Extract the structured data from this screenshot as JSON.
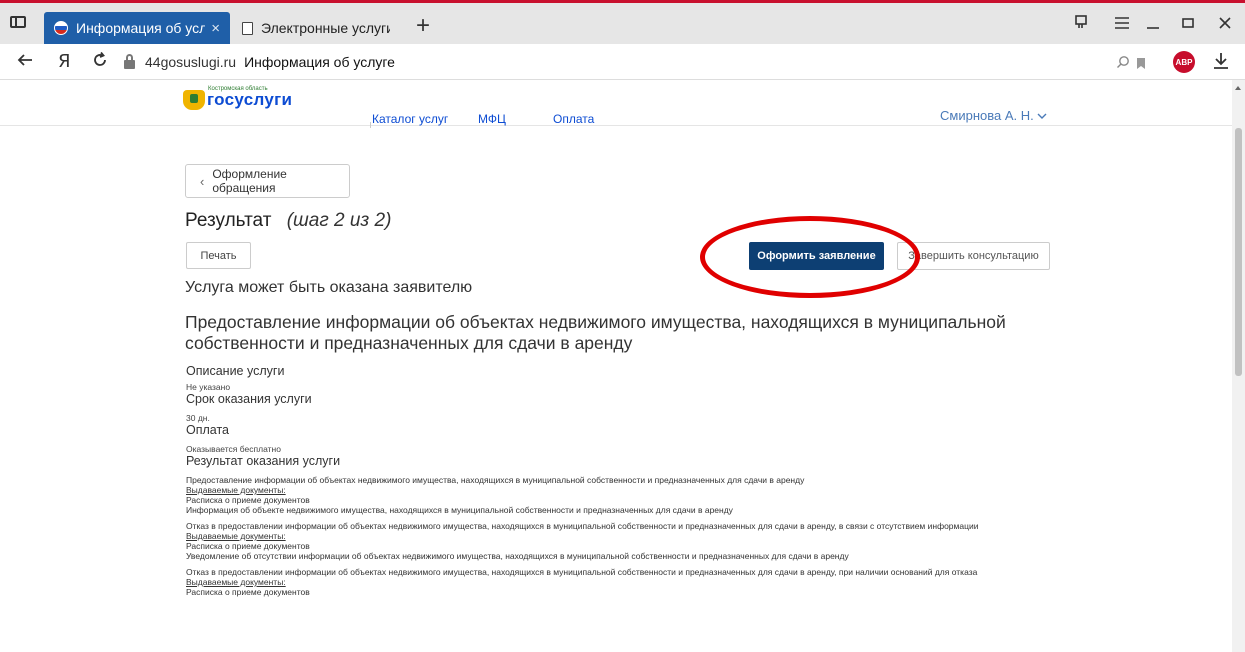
{
  "browser": {
    "tabs": [
      {
        "label": "Информация об услуге",
        "active": true
      },
      {
        "label": "Электронные услуги",
        "active": false
      }
    ],
    "close_glyph": "×",
    "newtab_glyph": "+",
    "url": {
      "domain": "44gosuslugi.ru",
      "title": "Информация об услуге"
    },
    "adblock_label": "ABP",
    "accent_color": "#1f5fa8"
  },
  "site": {
    "logo": {
      "text": "госуслуги",
      "small_text": "Костромская область"
    },
    "nav": [
      "Каталог услуг",
      "МФЦ",
      "Оплата"
    ],
    "user": "Смирнова А. Н."
  },
  "page": {
    "back_label": "Оформление обращения",
    "heading": "Результат",
    "step": "(шаг 2 из 2)",
    "print_label": "Печать",
    "primary_label": "Оформить заявление",
    "secondary_label": "Завершить консультацию",
    "availability": "Услуга может быть оказана заявителю",
    "service_title": "Предоставление информации об объектах недвижимого имущества, находящихся в муниципальной собственности и предназначенных для сдачи в аренду",
    "description": {
      "heading": "Описание услуги",
      "value": "Не указано"
    },
    "term": {
      "heading": "Срок оказания услуги",
      "value": "30 дн."
    },
    "payment": {
      "heading": "Оплата",
      "value": "Оказывается бесплатно"
    },
    "result": {
      "heading": "Результат оказания услуги",
      "items": [
        {
          "text": "Предоставление информации об объектах недвижимого имущества, находящихся в муниципальной собственности и предназначенных для сдачи в аренду",
          "docs_label": "Выдаваемые документы:",
          "docs": [
            "Расписка о приеме документов",
            "Информация об объекте недвижимого имущества, находящихся в муниципальной собственности и предназначенных для сдачи в аренду"
          ]
        },
        {
          "text": "Отказ в предоставлении информации об объектах недвижимого имущества, находящихся в муниципальной собственности и предназначенных для сдачи в аренду, в связи с отсутствием информации",
          "docs_label": "Выдаваемые документы:",
          "docs": [
            "Расписка о приеме документов",
            "Уведомление об отсутствии информации об объектах недвижимого имущества, находящихся в муниципальной собственности и предназначенных для сдачи в аренду"
          ]
        },
        {
          "text": "Отказ в предоставлении информации об объектах недвижимого имущества, находящихся в муниципальной собственности и предназначенных для сдачи в аренду, при наличии оснований для отказа",
          "docs_label": "Выдаваемые документы:",
          "docs": [
            "Расписка о приеме документов"
          ]
        }
      ]
    },
    "highlight_color": "#e00000",
    "primary_color": "#0d3f73"
  }
}
